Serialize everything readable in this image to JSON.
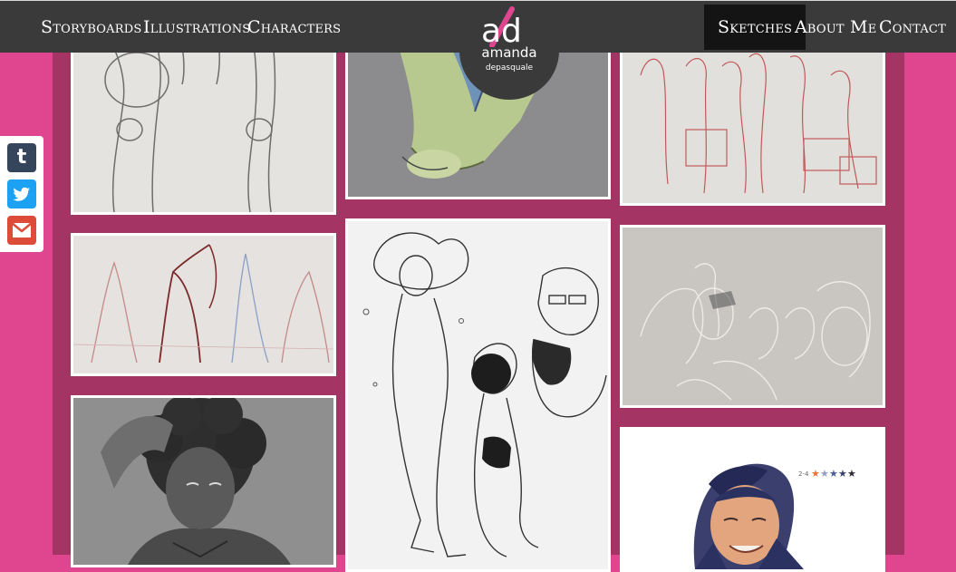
{
  "nav": {
    "left_items": [
      "Storyboards",
      "Illustrations",
      "Characters"
    ],
    "right_items": [
      "Sketches",
      "About Me",
      "Contact"
    ],
    "active": "Sketches"
  },
  "logo": {
    "mark": "ad",
    "name": "amanda",
    "surname": "depasquale"
  },
  "share": [
    {
      "service": "Tumblr",
      "glyph": "t",
      "color": "#35465c",
      "icon": "tumblr-icon"
    },
    {
      "service": "Twitter",
      "color": "#1da1f2",
      "icon": "twitter-bird-icon"
    },
    {
      "service": "Gmail",
      "color": "#dd4b39",
      "icon": "gmail-envelope-icon"
    }
  ],
  "gallery": [
    {
      "subject": "skeleton-legs-pencil"
    },
    {
      "subject": "figure-with-bow-red"
    },
    {
      "subject": "curly-hair-woman-gray"
    },
    {
      "subject": "seated-figure-blue-green"
    },
    {
      "subject": "ink-characters-floating"
    },
    {
      "subject": "seated-figures-red-pencil"
    },
    {
      "subject": "crouching-figures-gray"
    },
    {
      "subject": "smiling-character-color"
    }
  ],
  "palette_note": "2-4"
}
